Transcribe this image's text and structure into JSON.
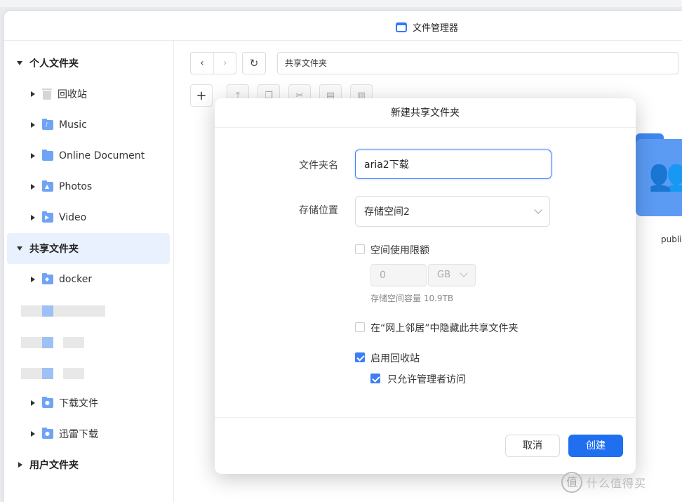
{
  "window": {
    "title": "文件管理器"
  },
  "sidebar": {
    "personal": {
      "label": "个人文件夹",
      "items": [
        {
          "label": "回收站"
        },
        {
          "label": "Music"
        },
        {
          "label": "Online Document"
        },
        {
          "label": "Photos"
        },
        {
          "label": "Video"
        }
      ]
    },
    "shared": {
      "label": "共享文件夹",
      "items": [
        {
          "label": "docker"
        },
        {
          "label": "下载文件"
        },
        {
          "label": "迅雷下载"
        }
      ]
    },
    "user": {
      "label": "用户文件夹"
    }
  },
  "toolbar": {
    "path": "共享文件夹"
  },
  "content": {
    "folder_label": "public"
  },
  "dialog": {
    "title": "新建共享文件夹",
    "name_label": "文件夹名",
    "name_value": "aria2下载",
    "location_label": "存储位置",
    "location_value": "存储空间2",
    "quota_label": "空间使用限额",
    "quota_value": "0",
    "quota_unit": "GB",
    "capacity_text": "存储空间容量 10.9TB",
    "hide_label": "在“网上邻居”中隐藏此共享文件夹",
    "recycle_label": "启用回收站",
    "admin_only_label": "只允许管理者访问",
    "cancel": "取消",
    "create": "创建"
  },
  "watermark": {
    "text": "什么值得买",
    "badge": "值"
  },
  "colors": {
    "accent": "#1f6ff0",
    "folder": "#6fa3f5",
    "selected_bg": "#e9f1fe"
  }
}
